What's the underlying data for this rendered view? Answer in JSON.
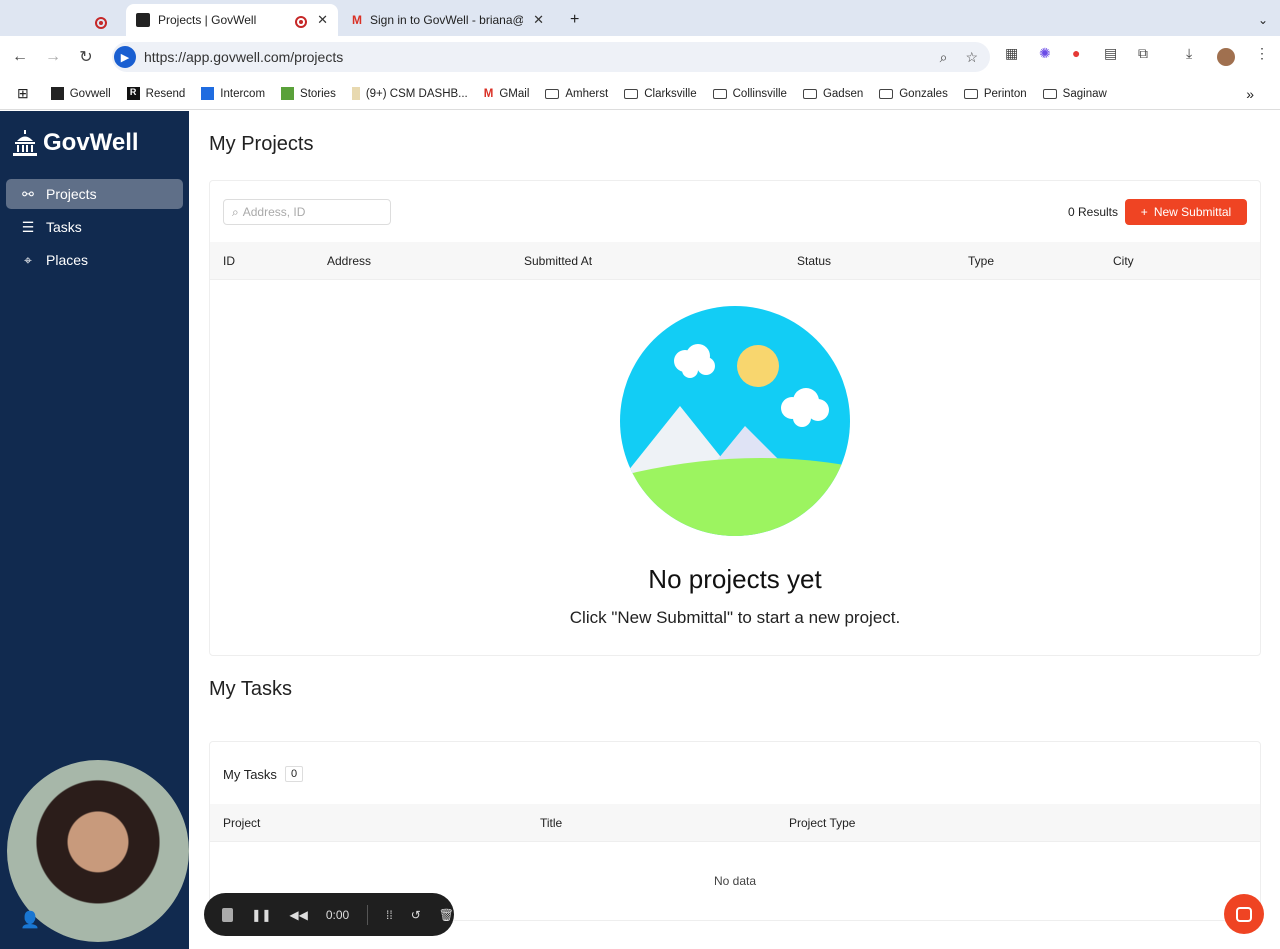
{
  "browser": {
    "tabs": [
      {
        "title": "Projects | GovWell",
        "active": true
      },
      {
        "title": "Sign in to GovWell - briana@g",
        "active": false
      }
    ],
    "new_tab": "+",
    "close": "✕",
    "url": "https://app.govwell.com/projects",
    "bookmarks": [
      {
        "label": "Govwell",
        "icon": "govwell-icon"
      },
      {
        "label": "Resend",
        "icon": "resend-icon"
      },
      {
        "label": "Intercom",
        "icon": "intercom-icon"
      },
      {
        "label": "Stories",
        "icon": "stories-icon"
      },
      {
        "label": "(9+) CSM DASHB...",
        "icon": "dashboard-icon"
      },
      {
        "label": "GMail",
        "icon": "gmail-icon"
      },
      {
        "label": "Amherst",
        "icon": "folder-icon"
      },
      {
        "label": "Clarksville",
        "icon": "folder-icon"
      },
      {
        "label": "Collinsville",
        "icon": "folder-icon"
      },
      {
        "label": "Gadsen",
        "icon": "folder-icon"
      },
      {
        "label": "Gonzales",
        "icon": "folder-icon"
      },
      {
        "label": "Perinton",
        "icon": "folder-icon"
      },
      {
        "label": "Saginaw",
        "icon": "folder-icon"
      }
    ],
    "more": "»"
  },
  "sidebar": {
    "brand": "GovWell",
    "items": [
      {
        "label": "Projects",
        "active": true
      },
      {
        "label": "Tasks",
        "active": false
      },
      {
        "label": "Places",
        "active": false
      }
    ]
  },
  "projects": {
    "title": "My Projects",
    "search_placeholder": "Address, ID",
    "results": "0 Results",
    "new_button": "New Submittal",
    "columns": [
      "ID",
      "Address",
      "Submitted At",
      "Status",
      "Type",
      "City"
    ],
    "empty_title": "No projects yet",
    "empty_subtitle": "Click \"New Submittal\" to start a new project."
  },
  "tasks": {
    "title": "My Tasks",
    "card_title": "My Tasks",
    "count": "0",
    "columns": [
      "Project",
      "Title",
      "Project Type"
    ],
    "empty": "No data"
  },
  "recorder": {
    "time": "0:00"
  },
  "colors": {
    "sidebar": "#112a4f",
    "accent": "#ef4423"
  }
}
